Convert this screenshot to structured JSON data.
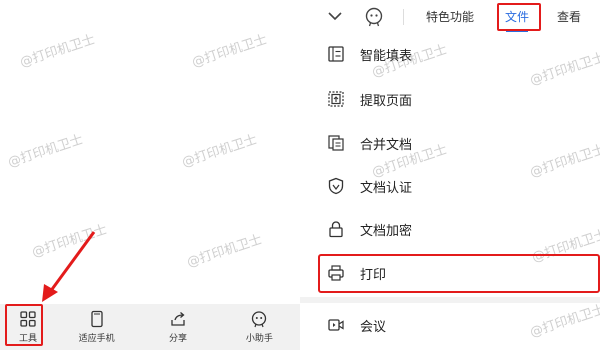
{
  "watermark": "@打印机卫士",
  "bottom_bar": {
    "items": [
      {
        "label": "工具",
        "icon": "grid-icon"
      },
      {
        "label": "适应手机",
        "icon": "phone-fit-icon"
      },
      {
        "label": "分享",
        "icon": "share-icon"
      },
      {
        "label": "小助手",
        "icon": "assistant-icon"
      }
    ]
  },
  "top_bar": {
    "tabs": [
      "特色功能",
      "文件",
      "查看"
    ],
    "active_tab": "文件"
  },
  "menu": {
    "items": [
      {
        "label": "智能填表",
        "icon": "form-fill-icon"
      },
      {
        "label": "提取页面",
        "icon": "extract-page-icon"
      },
      {
        "label": "合并文档",
        "icon": "merge-doc-icon"
      },
      {
        "label": "文档认证",
        "icon": "shield-icon"
      },
      {
        "label": "文档加密",
        "icon": "lock-icon"
      },
      {
        "label": "打印",
        "icon": "printer-icon"
      },
      {
        "label": "会议",
        "icon": "meeting-icon"
      }
    ]
  },
  "colors": {
    "highlight": "#e31b1b",
    "accent": "#2b6de0",
    "bar_bg": "#f1f1f1"
  }
}
